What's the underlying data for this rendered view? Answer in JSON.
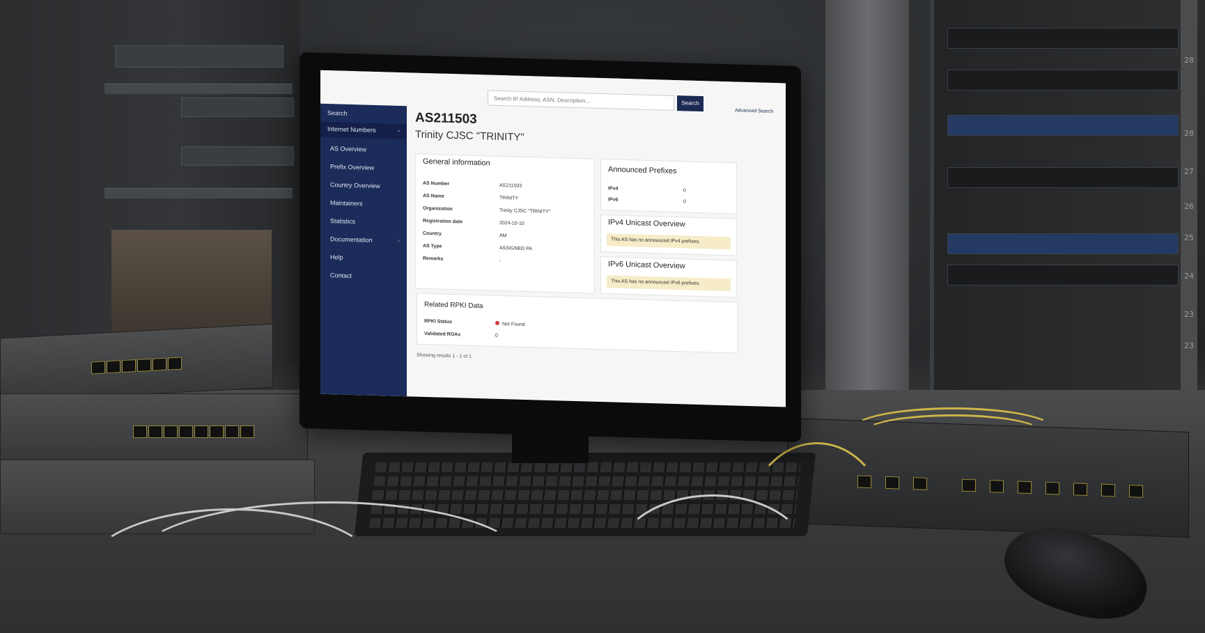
{
  "app": {
    "search": {
      "placeholder": "Search IP Address, ASN, Description...",
      "button": "Search"
    },
    "advanced_search": "Advanced Search",
    "sidebar": {
      "items": [
        {
          "label": "Search",
          "chev": ""
        },
        {
          "label": "Internet Numbers",
          "chev": "⌄"
        },
        {
          "label": "AS Overview",
          "chev": ""
        },
        {
          "label": "Prefix Overview",
          "chev": ""
        },
        {
          "label": "Country Overview",
          "chev": ""
        },
        {
          "label": "Maintainers",
          "chev": ""
        },
        {
          "label": "Statistics",
          "chev": ""
        },
        {
          "label": "Documentation",
          "chev": "›"
        },
        {
          "label": "Help",
          "chev": ""
        },
        {
          "label": "Contact",
          "chev": ""
        }
      ]
    },
    "header": {
      "as_number": "AS211503",
      "org": "Trinity CJSC \"TRINITY\""
    },
    "general": {
      "title": "General information",
      "rows": [
        {
          "k": "AS Number",
          "v": "AS211503"
        },
        {
          "k": "AS Name",
          "v": "TRINITY"
        },
        {
          "k": "Organization",
          "v": "Trinity CJSC \"TRINITY\""
        },
        {
          "k": "Registration date",
          "v": "2024-10-10"
        },
        {
          "k": "Country",
          "v": "AM"
        },
        {
          "k": "AS Type",
          "v": "ASSIGNED PA"
        },
        {
          "k": "Remarks",
          "v": "-"
        }
      ]
    },
    "announced": {
      "title": "Announced Prefixes",
      "ipv4_label": "IPv4",
      "ipv4_value": "0",
      "ipv6_label": "IPv6",
      "ipv6_value": "0"
    },
    "ipv4_unicast": {
      "title": "IPv4 Unicast Overview",
      "notice": "This AS has no announced IPv4 prefixes."
    },
    "ipv6_unicast": {
      "title": "IPv6 Unicast Overview",
      "notice": "This AS has no announced IPv6 prefixes."
    },
    "rpki": {
      "title": "Related RPKI Data",
      "status_label": "RPKI Status",
      "status_value": "Not Found",
      "status_color": "#d23a3a",
      "roas_label": "Validated ROAs",
      "roas_value": "0"
    },
    "footer": "Showing results 1 - 1 of 1"
  },
  "scene": {
    "rack_numbers": [
      "28",
      "28",
      "27",
      "26",
      "25",
      "24",
      "23",
      "23"
    ],
    "accent": "#1b2c5b"
  }
}
